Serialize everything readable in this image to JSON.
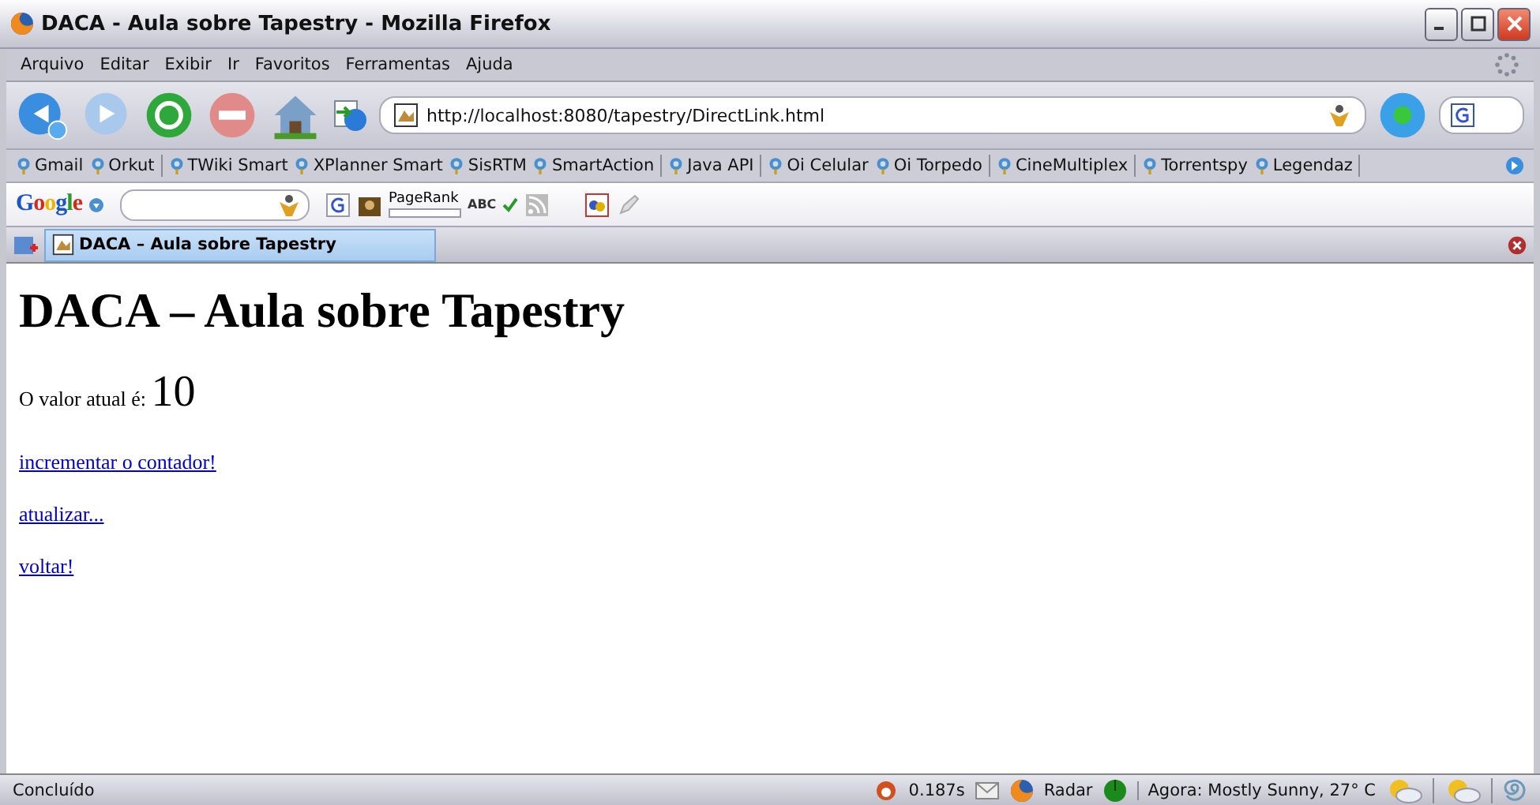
{
  "window": {
    "title": "DACA - Aula sobre Tapestry - Mozilla Firefox"
  },
  "menu": [
    "Arquivo",
    "Editar",
    "Exibir",
    "Ir",
    "Favoritos",
    "Ferramentas",
    "Ajuda"
  ],
  "address": {
    "value": "http://localhost:8080/tapestry/DirectLink.html"
  },
  "bookmarks": [
    {
      "label": "Gmail",
      "separator_after": false
    },
    {
      "label": "Orkut",
      "separator_after": true
    },
    {
      "label": "TWiki Smart",
      "separator_after": false
    },
    {
      "label": "XPlanner Smart",
      "separator_after": false
    },
    {
      "label": "SisRTM",
      "separator_after": false
    },
    {
      "label": "SmartAction",
      "separator_after": true
    },
    {
      "label": "Java API",
      "separator_after": true
    },
    {
      "label": "Oi Celular",
      "separator_after": false
    },
    {
      "label": "Oi Torpedo",
      "separator_after": true
    },
    {
      "label": "CineMultiplex",
      "separator_after": true
    },
    {
      "label": "Torrentspy",
      "separator_after": false
    },
    {
      "label": "Legendaz",
      "separator_after": true
    }
  ],
  "google_toolbar": {
    "logo": "Google",
    "pagerank_label": "PageRank",
    "pagerank": {
      "level": 0
    },
    "spellcheck_label": "ABC"
  },
  "tabs": [
    {
      "label": "DACA – Aula sobre Tapestry",
      "selected": true
    }
  ],
  "page": {
    "heading": "DACA – Aula sobre Tapestry",
    "value_label": "O valor atual é:",
    "value": "10",
    "links": [
      "incrementar o contador!",
      "atualizar...",
      "voltar!"
    ]
  },
  "status_bar": {
    "text": "Concluído",
    "timing": "0.187s",
    "radar": "Radar",
    "weather": "Agora: Mostly Sunny, 27° C"
  }
}
